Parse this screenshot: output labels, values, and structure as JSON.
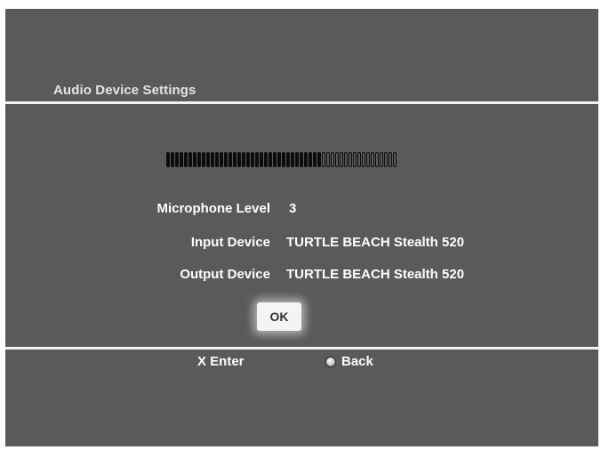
{
  "header": {
    "title": "Audio Device Settings"
  },
  "meter": {
    "filled_segments": 35,
    "total_segments": 52,
    "level_fraction": 0.673
  },
  "settings": {
    "microphone_level": {
      "label": "Microphone Level",
      "value": "3"
    },
    "input_device": {
      "label": "Input Device",
      "value": "TURTLE BEACH Stealth 520"
    },
    "output_device": {
      "label": "Output Device",
      "value": "TURTLE BEACH Stealth 520"
    }
  },
  "buttons": {
    "ok_label": "OK"
  },
  "footer": {
    "enter_label": "X Enter",
    "back_label": "Back",
    "back_icon": "circle-button-icon"
  },
  "colors": {
    "background": "#5a5a5b",
    "rule": "#f2f2f2",
    "text": "#ffffff",
    "title_text": "#e4e4e4",
    "button_bg": "#f4f4f4"
  }
}
